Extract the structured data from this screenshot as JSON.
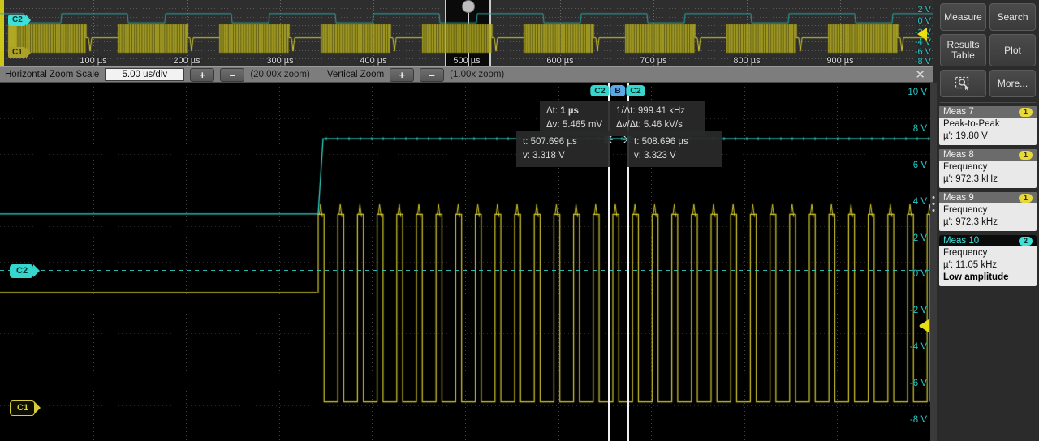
{
  "overview": {
    "time_labels": [
      "100 µs",
      "200 µs",
      "300 µs",
      "400 µs",
      "500 µs",
      "600 µs",
      "700 µs",
      "800 µs",
      "900 µs"
    ],
    "volt_labels": [
      "2 V",
      "0 V",
      "-2 V",
      "-4 V",
      "-6 V",
      "-8 V"
    ],
    "channel_badges": [
      {
        "id": "C2",
        "label": "C2"
      },
      {
        "id": "C1",
        "label": "C1"
      }
    ]
  },
  "zoombar": {
    "h_label": "Horizontal Zoom Scale",
    "h_value": "5.00 us/div",
    "plus": "+",
    "minus": "–",
    "h_factor": "(20.00x zoom)",
    "v_label": "Vertical Zoom",
    "v_factor": "(1.00x zoom)",
    "close": "✕"
  },
  "plot": {
    "volt_labels": [
      "10 V",
      "8 V",
      "6 V",
      "4 V",
      "2 V",
      "0 V",
      "-2 V",
      "-4 V",
      "-6 V",
      "-8 V"
    ],
    "cursor_tabs": [
      {
        "label": "C2",
        "kind": "c2"
      },
      {
        "label": "B",
        "kind": "b"
      },
      {
        "label": "C2",
        "kind": "c2"
      }
    ],
    "delta_readout": {
      "dt_key": "Δt:",
      "dt_val": "1 µs",
      "invdt_key": "1/Δt:",
      "invdt_val": "999.41 kHz",
      "dv_key": "Δv:",
      "dv_val": "5.465 mV",
      "slope_key": "Δv/Δt:",
      "slope_val": "5.46 kV/s"
    },
    "cursor_a": {
      "t": "t: 507.696 µs",
      "v": "v: 3.318 V"
    },
    "cursor_b": {
      "t": "t: 508.696 µs",
      "v": "v: 3.323 V"
    },
    "channel_tags": [
      {
        "label": "C2",
        "kind": "c2"
      },
      {
        "label": "C1",
        "kind": "c1"
      }
    ]
  },
  "sidebar": {
    "buttons": [
      {
        "name": "measure",
        "label": "Measure"
      },
      {
        "name": "search",
        "label": "Search"
      },
      {
        "name": "results-table",
        "label": "Results\nTable"
      },
      {
        "name": "plot",
        "label": "Plot"
      },
      {
        "name": "zoom-select",
        "label": ""
      },
      {
        "name": "more",
        "label": "More..."
      }
    ],
    "measurements": [
      {
        "title": "Meas 7",
        "pill": "1",
        "type": "Peak-to-Peak",
        "value": "µ': 19.80 V",
        "warning": "",
        "selected": false
      },
      {
        "title": "Meas 8",
        "pill": "1",
        "type": "Frequency",
        "value": "µ': 972.3 kHz",
        "warning": "",
        "selected": false
      },
      {
        "title": "Meas 9",
        "pill": "1",
        "type": "Frequency",
        "value": "µ': 972.3 kHz",
        "warning": "",
        "selected": false
      },
      {
        "title": "Meas 10",
        "pill": "2",
        "type": "Frequency",
        "value": "µ': 11.05 kHz",
        "warning": "Low amplitude",
        "selected": true
      }
    ]
  },
  "colors": {
    "ch1_yellow": "#d8cf2e",
    "ch2_cyan": "#34d6cd",
    "accent_grid": "#555555",
    "panel_bg": "#2b2b2b",
    "toolbar_bg": "#7d7d7d"
  }
}
